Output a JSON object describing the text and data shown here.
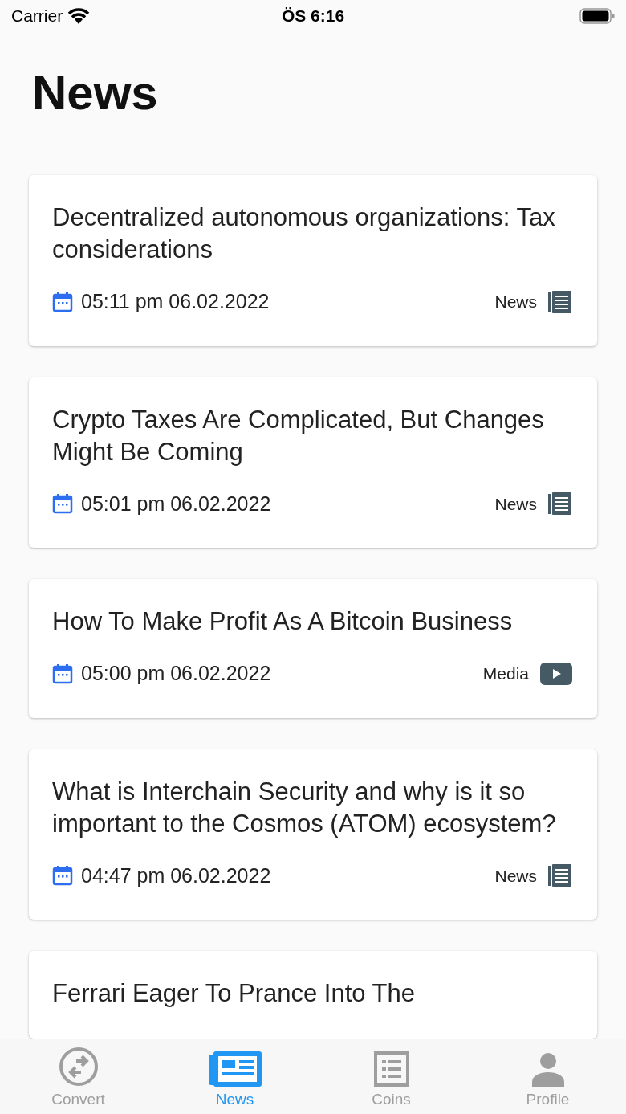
{
  "status_bar": {
    "carrier": "Carrier",
    "time": "ÖS 6:16"
  },
  "title": "News",
  "articles": [
    {
      "title": "Decentralized autonomous organizations: Tax considerations",
      "date": "05:11 pm 06.02.2022",
      "category": "News",
      "kind": "news"
    },
    {
      "title": "Crypto Taxes Are Complicated, But Changes Might Be Coming",
      "date": "05:01 pm 06.02.2022",
      "category": "News",
      "kind": "news"
    },
    {
      "title": "How To Make Profit As A Bitcoin Business",
      "date": "05:00 pm 06.02.2022",
      "category": "Media",
      "kind": "media"
    },
    {
      "title": "What is Interchain Security and why is it so important to the Cosmos (ATOM) ecosystem?",
      "date": "04:47 pm 06.02.2022",
      "category": "News",
      "kind": "news"
    },
    {
      "title": "Ferrari Eager To Prance Into The"
    }
  ],
  "tabs": [
    {
      "label": "Convert",
      "kind": "convert",
      "selected": false
    },
    {
      "label": "News",
      "kind": "news",
      "selected": true
    },
    {
      "label": "Coins",
      "kind": "coins",
      "selected": false
    },
    {
      "label": "Profile",
      "kind": "profile",
      "selected": false
    }
  ]
}
